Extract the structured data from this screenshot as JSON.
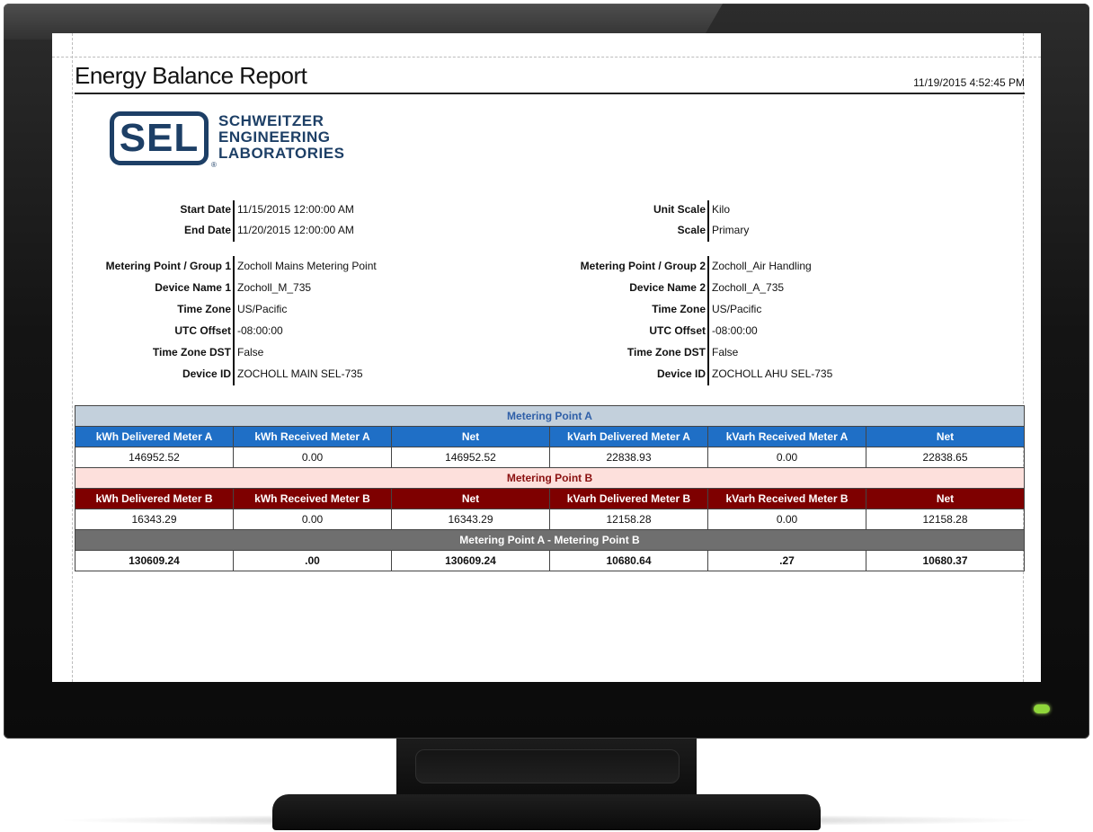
{
  "report": {
    "title": "Energy Balance Report",
    "generated": "11/19/2015 4:52:45 PM"
  },
  "logo": {
    "mark": "SEL",
    "reg": "®",
    "line1": "SCHWEITZER",
    "line2": "ENGINEERING",
    "line3": "LABORATORIES"
  },
  "left_info": [
    {
      "label": "Start Date",
      "value": "11/15/2015 12:00:00 AM"
    },
    {
      "label": "End Date",
      "value": "11/20/2015 12:00:00 AM"
    },
    {
      "label": "Metering Point / Group 1",
      "value": "Zocholl Mains Metering Point"
    },
    {
      "label": "Device Name 1",
      "value": "Zocholl_M_735"
    },
    {
      "label": "Time Zone",
      "value": "US/Pacific"
    },
    {
      "label": "UTC Offset",
      "value": "-08:00:00"
    },
    {
      "label": "Time Zone DST",
      "value": "False"
    },
    {
      "label": "Device ID",
      "value": "ZOCHOLL MAIN SEL-735"
    }
  ],
  "right_info": [
    {
      "label": "Unit Scale",
      "value": "Kilo"
    },
    {
      "label": "Scale",
      "value": "Primary"
    },
    {
      "label": "Metering Point / Group 2",
      "value": "Zocholl_Air Handling"
    },
    {
      "label": "Device Name 2",
      "value": "Zocholl_A_735"
    },
    {
      "label": "Time Zone",
      "value": "US/Pacific"
    },
    {
      "label": "UTC Offset",
      "value": "-08:00:00"
    },
    {
      "label": "Time Zone DST",
      "value": "False"
    },
    {
      "label": "Device ID",
      "value": "ZOCHOLL AHU SEL-735"
    }
  ],
  "table": {
    "section_a": "Metering Point A",
    "headers_a": [
      "kWh Delivered  Meter A",
      "kWh Received  Meter A",
      "Net",
      "kVarh Delivered Meter A",
      "kVarh Received Meter A",
      "Net"
    ],
    "values_a": [
      "146952.52",
      "0.00",
      "146952.52",
      "22838.93",
      "0.00",
      "22838.65"
    ],
    "section_b": "Metering Point B",
    "headers_b": [
      "kWh Delivered Meter B",
      "kWh Received Meter B",
      "Net",
      "kVarh Delivered Meter B",
      "kVarh Received Meter B",
      "Net"
    ],
    "values_b": [
      "16343.29",
      "0.00",
      "16343.29",
      "12158.28",
      "0.00",
      "12158.28"
    ],
    "section_diff": "Metering Point A - Metering Point B",
    "values_diff": [
      "130609.24",
      ".00",
      "130609.24",
      "10680.64",
      ".27",
      "10680.37"
    ]
  },
  "colors": {
    "brand_navy": "#1d3f66",
    "meter_a_header": "#1f6fc6",
    "meter_b_header": "#7e0000",
    "difference_header": "#6f6f6f",
    "power_led": "#8fd63a"
  }
}
